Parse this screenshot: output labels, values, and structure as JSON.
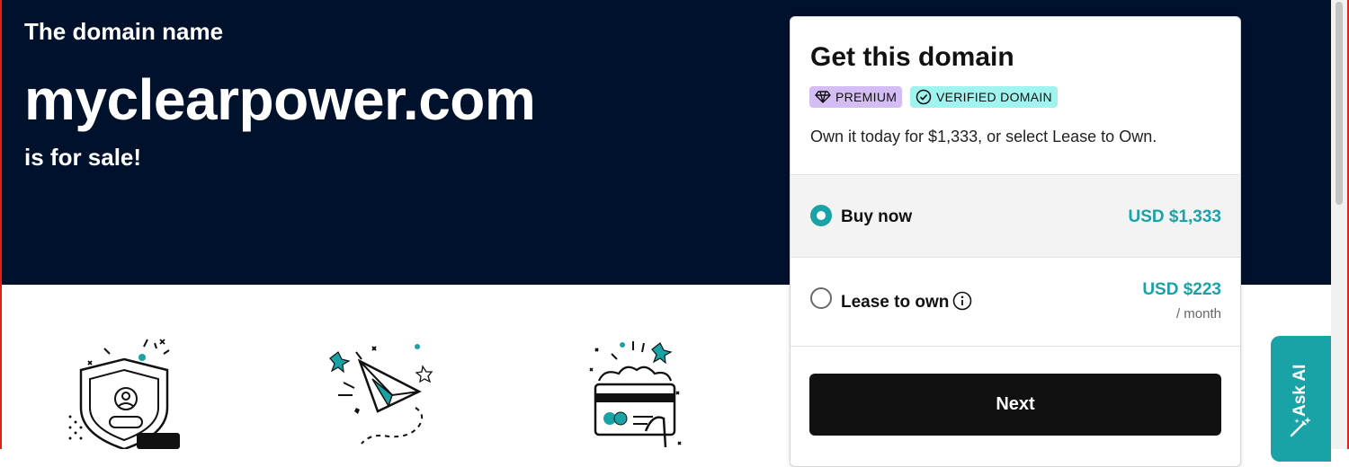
{
  "hero": {
    "lead": "The domain name",
    "domain": "myclearpower.com",
    "tail": "is for sale!"
  },
  "card": {
    "title": "Get this domain",
    "badges": {
      "premium": "PREMIUM",
      "verified": "VERIFIED DOMAIN"
    },
    "description": "Own it today for $1,333, or select Lease to Own.",
    "options": {
      "buy": {
        "label": "Buy now",
        "price": "USD $1,333",
        "selected": true
      },
      "lease": {
        "label": "Lease to own",
        "price": "USD $223",
        "period": "/ month",
        "selected": false
      }
    },
    "next_label": "Next"
  },
  "ask_ai": {
    "label": "Ask AI"
  },
  "colors": {
    "hero_bg": "#00112c",
    "accent_teal": "#1aa3a6",
    "premium_badge": "#d4bdf5",
    "verified_badge": "#9ff4ef",
    "button_dark": "#111111"
  },
  "icons": [
    "diamond-icon",
    "check-circle-icon",
    "info-icon",
    "shield-user-icon",
    "paper-plane-icon",
    "hand-card-icon",
    "magic-wand-icon"
  ]
}
